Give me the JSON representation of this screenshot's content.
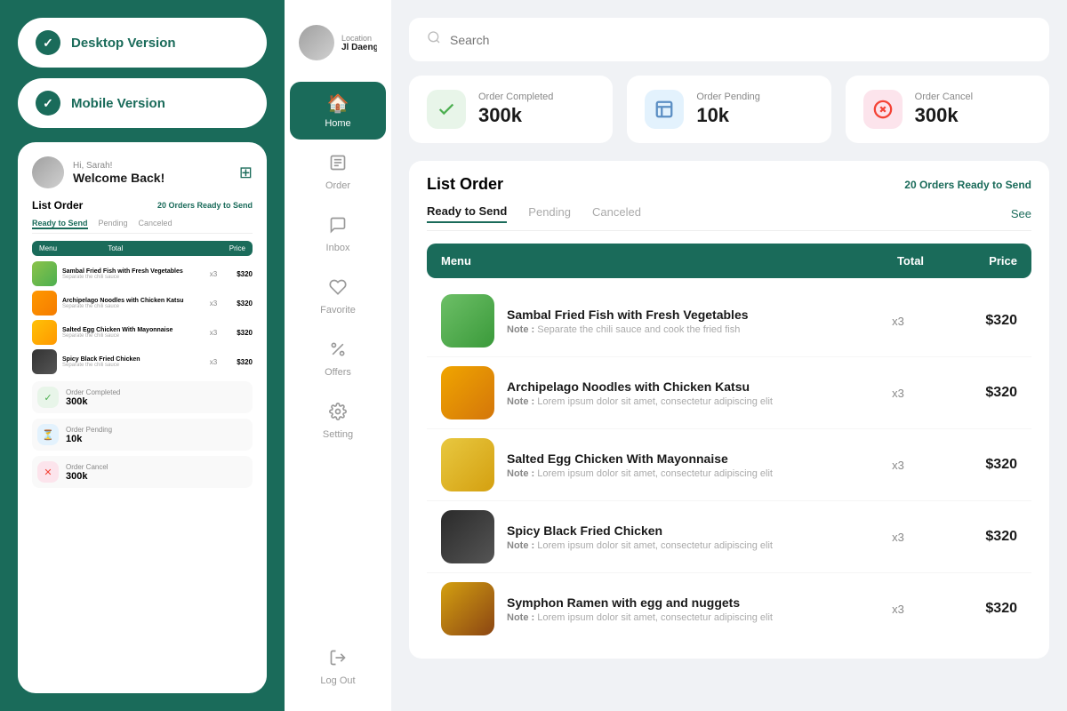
{
  "leftPanel": {
    "desktopBtn": "Desktop Version",
    "mobileBtn": "Mobile Version",
    "mobile": {
      "hi": "Hi, Sarah!",
      "welcome": "Welcome Back!",
      "listOrder": "List Order",
      "badge": "20 Orders Ready to Send",
      "tabs": [
        "Ready to Send",
        "Pending",
        "Canceled"
      ],
      "tableHeaders": [
        "Menu",
        "Total",
        "Price"
      ],
      "foods": [
        {
          "name": "Sambal Fried Fish with Fresh Vegetables",
          "note": "Separate the chili sauce",
          "qty": "x3",
          "price": "$320",
          "img": "fish"
        },
        {
          "name": "Archipelago Noodles with Chicken Katsu",
          "note": "Separate the chili sauce",
          "qty": "x3",
          "price": "$320",
          "img": "noodles"
        },
        {
          "name": "Salted Egg Chicken With Mayonnaise",
          "note": "Separate the chili sauce",
          "qty": "x3",
          "price": "$320",
          "img": "egg"
        },
        {
          "name": "Spicy Black Fried Chicken",
          "note": "Separate the chili sauce",
          "qty": "x3",
          "price": "$320",
          "img": "chicken"
        }
      ],
      "stats": [
        {
          "label": "Order Completed",
          "value": "300k",
          "type": "green"
        },
        {
          "label": "Order Pending",
          "value": "10k",
          "type": "blue"
        },
        {
          "label": "Order Cancel",
          "value": "300k",
          "type": "red"
        }
      ]
    }
  },
  "nav": {
    "locationLabel": "Location",
    "locationValue": "Jl Daeng Barat",
    "items": [
      {
        "label": "Home",
        "icon": "🏠",
        "active": true
      },
      {
        "label": "Order",
        "icon": "📋",
        "active": false
      },
      {
        "label": "Inbox",
        "icon": "📨",
        "active": false
      },
      {
        "label": "Favorite",
        "icon": "♡",
        "active": false
      },
      {
        "label": "Offers",
        "icon": "%",
        "active": false
      },
      {
        "label": "Setting",
        "icon": "⚙",
        "active": false
      }
    ],
    "logout": "Log Out"
  },
  "main": {
    "search": {
      "placeholder": "Search"
    },
    "stats": [
      {
        "label": "Order Completed",
        "value": "300k",
        "type": "green"
      },
      {
        "label": "Order Pending",
        "value": "10k",
        "type": "blue"
      },
      {
        "label": "Order Cancel",
        "value": "300k",
        "type": "red"
      }
    ],
    "listOrder": {
      "title": "List Order",
      "badge": "20 Orders Ready to Send",
      "tabs": [
        "Ready to Send",
        "Pending",
        "Canceled"
      ],
      "seeAll": "See",
      "tableHeaders": [
        "Menu",
        "Total",
        "Price"
      ],
      "foods": [
        {
          "name": "Sambal Fried Fish with Fresh Vegetables",
          "note": "Separate the chili sauce and cook the fried fish",
          "qty": "x3",
          "price": "$320",
          "img": "fish"
        },
        {
          "name": "Archipelago Noodles with Chicken Katsu",
          "note": "Lorem ipsum dolor sit amet, consectetur adipiscing elit",
          "qty": "x3",
          "price": "$320",
          "img": "noodles"
        },
        {
          "name": "Salted Egg Chicken With Mayonnaise",
          "note": "Lorem ipsum dolor sit amet, consectetur adipiscing elit",
          "qty": "x3",
          "price": "$320",
          "img": "egg-chick"
        },
        {
          "name": "Spicy Black Fried Chicken",
          "note": "Lorem ipsum dolor sit amet, consectetur adipiscing elit",
          "qty": "x3",
          "price": "$320",
          "img": "black-chick"
        },
        {
          "name": "Symphon Ramen with egg and nuggets",
          "note": "Lorem ipsum dolor sit amet, consectetur adipiscing elit",
          "qty": "x3",
          "price": "$320",
          "img": "ramen"
        }
      ]
    }
  }
}
